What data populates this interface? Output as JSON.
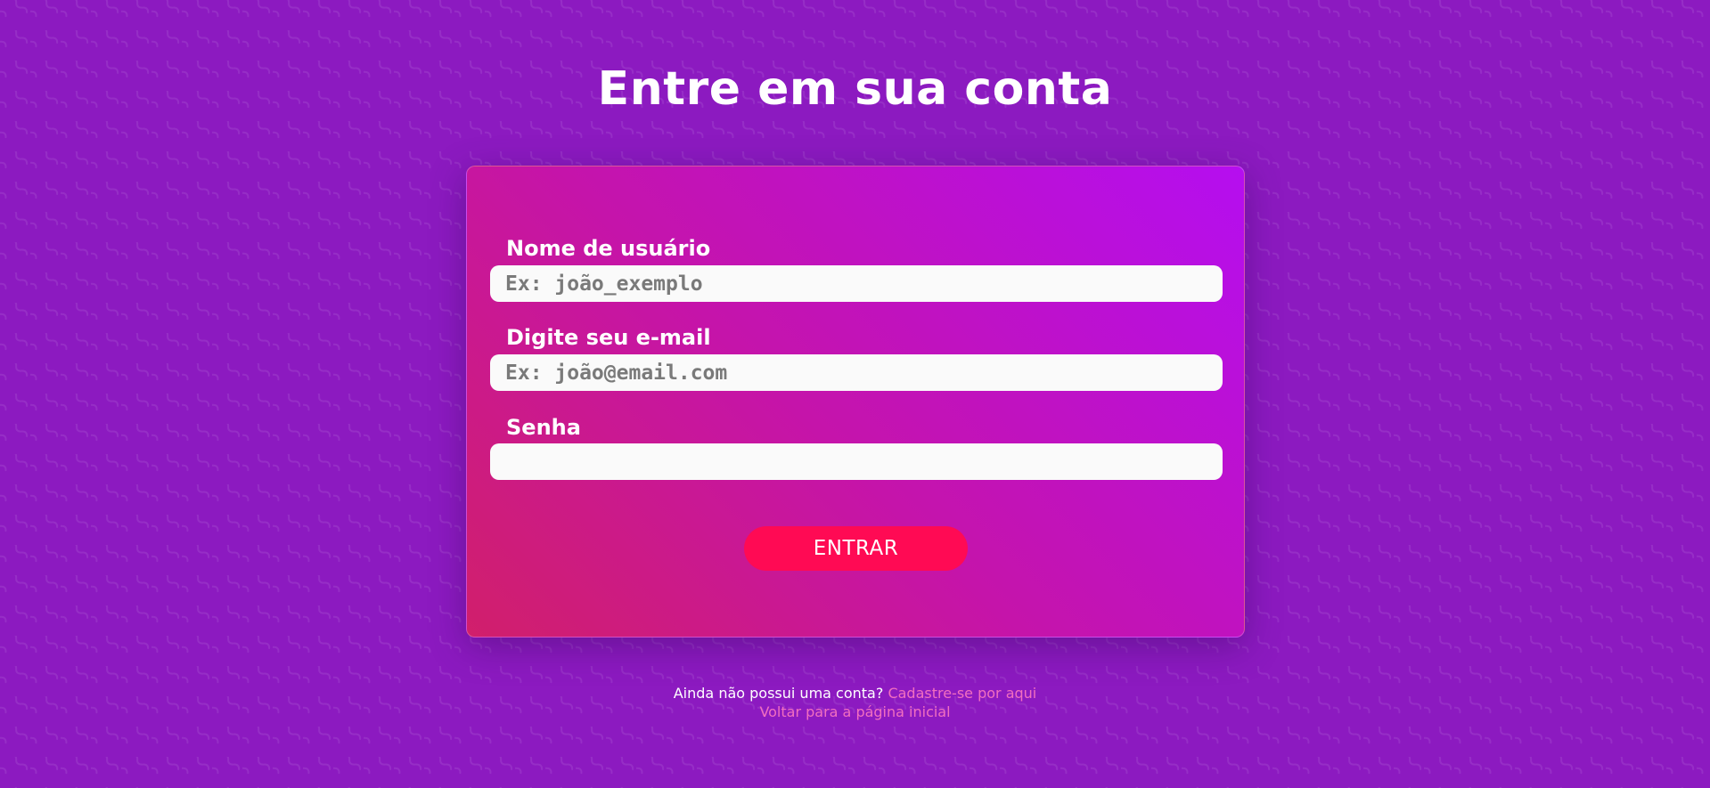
{
  "page": {
    "title": "Entre em sua conta"
  },
  "form": {
    "username": {
      "label": "Nome de usuário",
      "placeholder": "Ex: joão_exemplo",
      "value": ""
    },
    "email": {
      "label": "Digite seu e-mail",
      "placeholder": "Ex: joão@email.com",
      "value": ""
    },
    "password": {
      "label": "Senha",
      "placeholder": "",
      "value": ""
    },
    "submit_label": "ENTRAR"
  },
  "footer": {
    "no_account_text": "Ainda não possui uma conta?",
    "signup_link": "Cadastre-se por aqui",
    "home_link": "Voltar para a página inicial"
  },
  "colors": {
    "background": "#8c1ac0",
    "card_gradient_start": "#d11f6b",
    "card_gradient_end": "#b50ef0",
    "button": "#ff0a54",
    "link": "#f26fbf"
  }
}
